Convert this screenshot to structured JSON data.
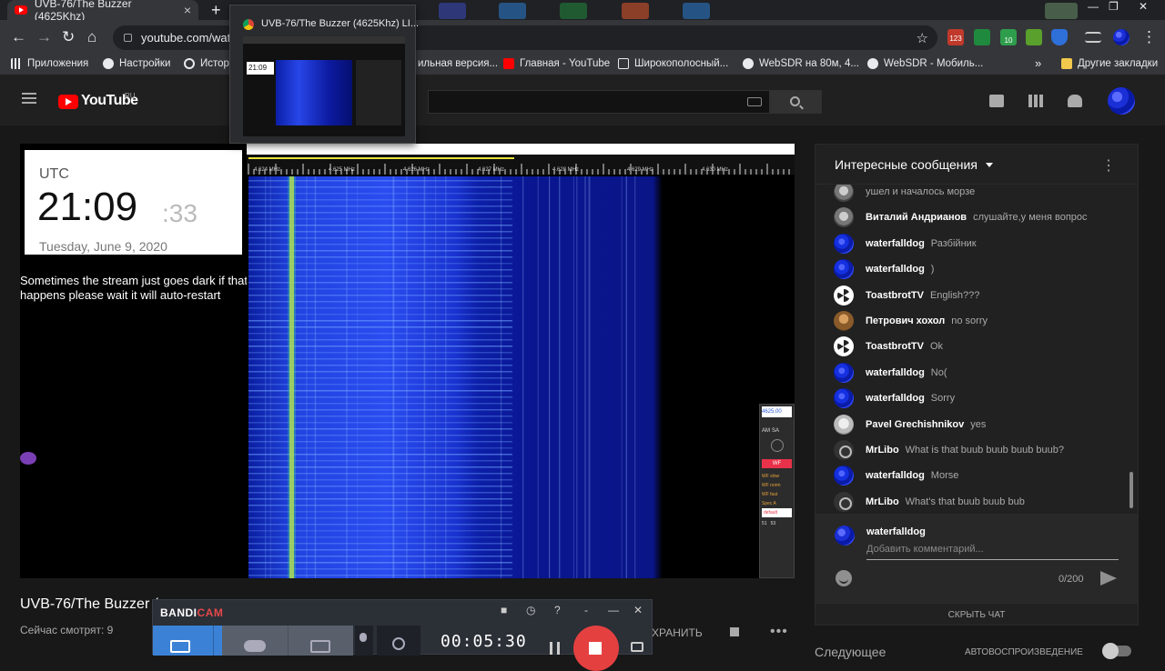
{
  "browser": {
    "tab_title": "UVB-76/The Buzzer (4625Khz)",
    "tab_close": "×",
    "new_tab": "+",
    "win_min": "—",
    "win_max": "❐",
    "win_close": "✕",
    "url": "youtube.com/wat",
    "bookmarks": [
      {
        "label": "Приложения",
        "icon": "apps-grid-icon",
        "color": "#e8eaed"
      },
      {
        "label": "Настройки",
        "icon": "gear-icon",
        "color": "#e8eaed"
      },
      {
        "label": "Истор",
        "icon": "history-icon",
        "color": "#e8eaed"
      },
      {
        "label": "ильная версия...",
        "icon": "page-icon",
        "color": "#e8eaed"
      },
      {
        "label": "Главная - YouTube",
        "icon": "youtube-icon",
        "color": "#ff0000"
      },
      {
        "label": "Широкополосный...",
        "icon": "radio-icon",
        "color": "#e8eaed"
      },
      {
        "label": "WebSDR на 80м, 4...",
        "icon": "websdr-icon",
        "color": "#e8eaed"
      },
      {
        "label": "WebSDR - Мобиль...",
        "icon": "websdr-icon",
        "color": "#e8eaed"
      }
    ],
    "bookmarks_more": "»",
    "other_bookmarks": "Другие закладки",
    "ext_badges": [
      "123",
      "10"
    ]
  },
  "tab_preview": {
    "title": "UVB-76/The Buzzer (4625Khz) LI...",
    "thumb_time": "21:09"
  },
  "youtube": {
    "logo_text": "YouTube",
    "region": "RU",
    "video_title": "UVB-76/The Buzzer (",
    "viewers": "Сейчас смотрят: 9",
    "save_label": "ХРАНИТЬ",
    "more": "•••",
    "next_label": "Следующее",
    "autoplay_label": "АВТОВОСПРОИЗВЕДЕНИЕ"
  },
  "player": {
    "clock_zone": "UTC",
    "clock_time": "21:09",
    "clock_seconds": ":33",
    "clock_date": "Tuesday, June 9, 2020",
    "notice": "Sometimes the stream just goes dark if that happens please wait it will auto-restart",
    "freq_labels": [
      "4.624 MHz",
      "4.625 MHz",
      "4.626 MHz",
      "4.627 MHz",
      "4.628 MHz",
      "4.629 MHz",
      "4.630 MHz"
    ],
    "sdr_panel": {
      "freq": "4625.00",
      "modes": [
        "AM",
        "SA"
      ],
      "active": "WF",
      "options": [
        "WF slow",
        "WF norm",
        "WF fast",
        "Spec A",
        "default"
      ],
      "footer": [
        "51",
        "53"
      ]
    }
  },
  "chat": {
    "header": "Интересные сообщения",
    "kebab": "⋮",
    "messages": [
      {
        "author": "",
        "text": "ушел и началось морзе",
        "avatar": "gray"
      },
      {
        "author": "Виталий Андрианов",
        "text": "слушайте,у меня вопрос",
        "avatar": "gray"
      },
      {
        "author": "waterfalldog",
        "text": "Разбійник",
        "avatar": "blue"
      },
      {
        "author": "waterfalldog",
        "text": ")",
        "avatar": "blue"
      },
      {
        "author": "ToastbrotTV",
        "text": "English???",
        "avatar": "toast"
      },
      {
        "author": "Петрович хохол",
        "text": "no sorry",
        "avatar": "brown"
      },
      {
        "author": "ToastbrotTV",
        "text": "Ok",
        "avatar": "toast"
      },
      {
        "author": "waterfalldog",
        "text": "No(",
        "avatar": "blue"
      },
      {
        "author": "waterfalldog",
        "text": "Sorry",
        "avatar": "blue"
      },
      {
        "author": "Pavel Grechishnikov",
        "text": "yes",
        "avatar": "face"
      },
      {
        "author": "MrLibo",
        "text": "What is that buub buub buub buub?",
        "avatar": "dark"
      },
      {
        "author": "waterfalldog",
        "text": "Morse",
        "avatar": "blue"
      },
      {
        "author": "MrLibo",
        "text": "What's that buub buub bub",
        "avatar": "dark"
      }
    ],
    "input_author": "waterfalldog",
    "input_placeholder": "Добавить комментарий...",
    "char_count": "0/200",
    "hide_chat": "СКРЫТЬ ЧАТ"
  },
  "bandicam": {
    "brand_a": "BANDI",
    "brand_b": "CAM",
    "timer": "00:05:30",
    "help": "?",
    "minimize": "-",
    "restore": "—",
    "close": "✕"
  },
  "colors": {
    "accent_red": "#ff0000",
    "waterfall_blue": "#1a2fd6",
    "signal_yellow": "#e8e23a"
  }
}
